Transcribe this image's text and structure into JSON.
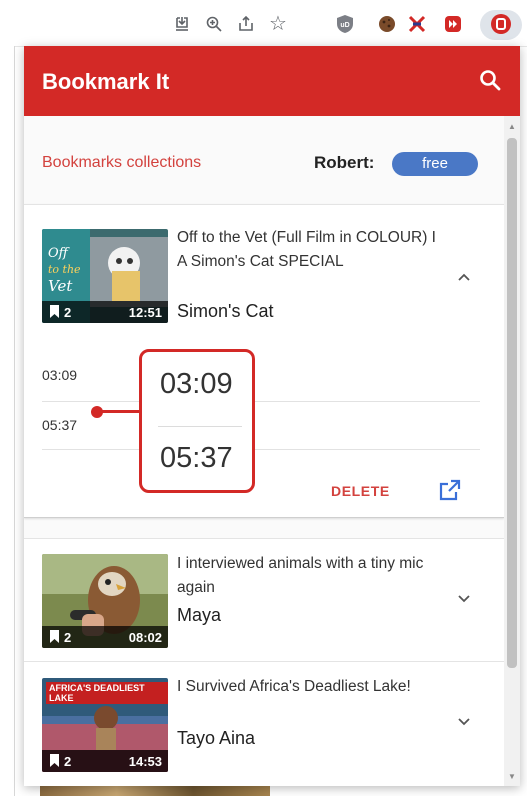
{
  "colors": {
    "header_red": "#d32926",
    "link_red": "#d3423e",
    "badge_blue": "#4a78c6"
  },
  "browser_toolbar": {
    "icons": [
      "download-icon",
      "zoom-icon",
      "share-icon",
      "star-icon",
      "ublock-icon",
      "cookie-icon",
      "extension-x-icon",
      "media-extension-icon",
      "bookmark-it-icon"
    ]
  },
  "header": {
    "title": "Bookmark It",
    "search_icon": "search-icon"
  },
  "account": {
    "collections_link": "Bookmarks collections",
    "user_name": "Robert:",
    "plan": "free"
  },
  "videos": [
    {
      "title": "Off to the Vet (Full Film in COLOUR) I A Simon's Cat SPECIAL",
      "channel": "Simon's Cat",
      "bookmark_count": "2",
      "duration": "12:51",
      "expanded": true,
      "bookmarks": [
        "03:09",
        "05:37"
      ],
      "delete_label": "DELETE"
    },
    {
      "title": "I interviewed animals with a tiny mic again",
      "channel": "Maya",
      "bookmark_count": "2",
      "duration": "08:02",
      "expanded": false
    },
    {
      "title": "I Survived Africa's Deadliest Lake!",
      "channel": "Tayo Aina",
      "bookmark_count": "2",
      "duration": "14:53",
      "expanded": false,
      "thumb_overlay": "AFRICA'S DEADLIEST LAKE"
    }
  ],
  "callout": {
    "times": [
      "03:09",
      "05:37"
    ]
  }
}
